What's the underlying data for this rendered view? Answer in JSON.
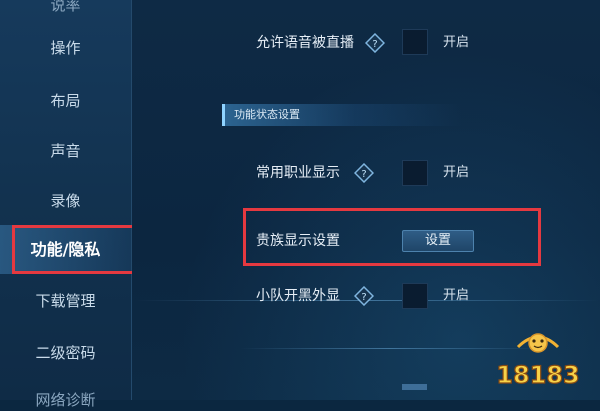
{
  "sidebar": {
    "items": [
      {
        "label": "说率",
        "state": "partial"
      },
      {
        "label": "操作"
      },
      {
        "label": "布局"
      },
      {
        "label": "声音"
      },
      {
        "label": "录像"
      },
      {
        "label": "功能/隐私",
        "state": "active"
      },
      {
        "label": "下载管理"
      },
      {
        "label": "二级密码"
      },
      {
        "label": "网络诊断",
        "state": "partial"
      }
    ]
  },
  "main": {
    "rows": [
      {
        "label": "允许语音被直播",
        "toggle_label": "开启"
      },
      {
        "label": "常用职业显示",
        "toggle_label": "开启"
      },
      {
        "label": "贵族显示设置",
        "button_label": "设置"
      },
      {
        "label": "小队开黑外显",
        "toggle_label": "开启"
      }
    ],
    "section_title": "功能状态设置"
  },
  "watermark": {
    "text": "18183"
  },
  "colors": {
    "highlight_box": "#e53940",
    "background": "#0b2740",
    "accent": "#8fd3ff"
  },
  "icons": {
    "help": "question-diamond-icon"
  }
}
